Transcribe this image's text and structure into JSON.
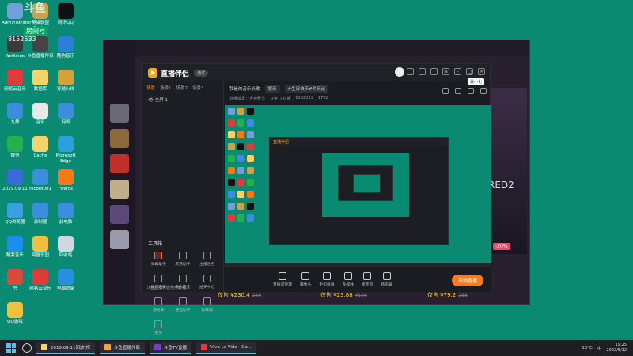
{
  "desktop": {
    "overlay_badge": "斗鱼",
    "overlay_name": "房间号",
    "overlay_num": "8152533",
    "icons": [
      {
        "label": "Administrator",
        "color": "#6fa0d8"
      },
      {
        "label": "英雄联盟 Online",
        "color": "#c9a24a"
      },
      {
        "label": "腾讯QQ",
        "color": "#111111"
      },
      {
        "label": "WeGame",
        "color": "#3a3a3a"
      },
      {
        "label": "斗鱼直播伴侣",
        "color": "#444444"
      },
      {
        "label": "酷狗音乐",
        "color": "#2a7fd9"
      },
      {
        "label": "网易云音乐",
        "color": "#e03b3b"
      },
      {
        "label": "数据库",
        "color": "#f4d36a"
      },
      {
        "label": "穿越火线",
        "color": "#d6a040"
      },
      {
        "label": "九舞",
        "color": "#3a8edb"
      },
      {
        "label": "音乐",
        "color": "#e8e8e8"
      },
      {
        "label": "网络",
        "color": "#3a8edb"
      },
      {
        "label": "微信",
        "color": "#22b14c"
      },
      {
        "label": "Cache",
        "color": "#f4d36a"
      },
      {
        "label": "Microsoft Edge",
        "color": "#2aa1d8"
      },
      {
        "label": "2019.09.11",
        "color": "#3a6ad8"
      },
      {
        "label": "record001",
        "color": "#3a8edb"
      },
      {
        "label": "Firefox",
        "color": "#f27a1a"
      },
      {
        "label": "QQ浏览器",
        "color": "#3aa0e0"
      },
      {
        "label": "录制器",
        "color": "#3a8edb"
      },
      {
        "label": "此电脑",
        "color": "#3a8edb"
      },
      {
        "label": "酷我音乐",
        "color": "#1d8ef0"
      },
      {
        "label": "阿狸乐园",
        "color": "#f0c040"
      },
      {
        "label": "回收站",
        "color": "#cfd8e0"
      },
      {
        "label": "书",
        "color": "#d84a3a"
      },
      {
        "label": "网易云音乐",
        "color": "#e03b3b"
      },
      {
        "label": "电脑管家",
        "color": "#2a8ee0"
      },
      {
        "label": "QQ游戏",
        "color": "#f0c040"
      }
    ]
  },
  "launcher": {
    "store_text": "RED2",
    "store_pct": "-20%",
    "version": "v2.0.7",
    "prices": [
      {
        "now": "仅售 ¥230.4",
        "old": "288"
      },
      {
        "now": "仅售 ¥23.88",
        "old": "¥199"
      },
      {
        "now": "仅售 ¥79.2",
        "old": "288"
      }
    ],
    "game_tiles": [
      "#6a6a72",
      "#8a6a3a",
      "#c0302a",
      "#c0b08a",
      "#5a4a7a",
      "#9a9aa8"
    ]
  },
  "app": {
    "title": "直播伴侣",
    "version_badge": "测试",
    "tooltip": "最小化",
    "scene_tabs": [
      "场景",
      "场景1",
      "场景2",
      "场景3"
    ],
    "source_label": "全屏 1",
    "live_title": "我是的音乐长歌",
    "live_tag": "娱乐",
    "live_tag2": "#生日快乐#的乐迷",
    "room_info": [
      "直播设置：大神赛节",
      "斗鱼TV直播",
      "8152533",
      "1792"
    ],
    "tools_title": "工具箱",
    "tools": [
      {
        "label": "弹幕助手",
        "hl": true
      },
      {
        "label": "房管助手",
        "hl": false
      },
      {
        "label": "主播任务",
        "hl": false
      },
      {
        "label": "视频连麦",
        "hl": false
      },
      {
        "label": "多人连麦",
        "hl": false
      },
      {
        "label": "抽奖中心",
        "hl": false
      },
      {
        "label": "游戏库",
        "hl": false
      },
      {
        "label": "语音助手",
        "hl": false
      },
      {
        "label": "弹幕墙",
        "hl": false
      },
      {
        "label": "更多",
        "hl": false
      }
    ],
    "bottom_hint": "斗鱼直播伴侣使用教程",
    "controls": [
      "直播间管理",
      "摄像头",
      "手机投屏",
      "多媒体",
      "麦克风",
      "扬声器"
    ],
    "start_label": "开始直播"
  },
  "taskbar": {
    "tasks": [
      {
        "label": "2019.09.11回放\\视",
        "color": "#f4d36a"
      },
      {
        "label": "斗鱼直播伴侣",
        "color": "#f5a623"
      },
      {
        "label": "斗鱼TV直播",
        "color": "#7a3ad8"
      },
      {
        "label": "Viva La Vida - Da...",
        "color": "#e03b3b"
      }
    ],
    "weather": "13°C",
    "lang": "中",
    "time": "19:25",
    "date": "2022/5/12"
  }
}
